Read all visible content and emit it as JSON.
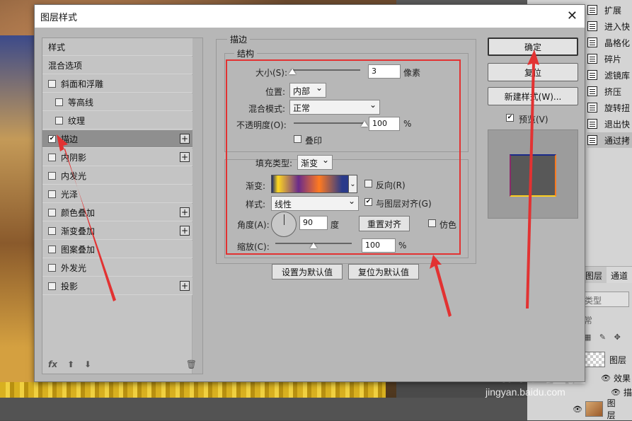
{
  "background": {
    "right_panel_items": [
      "扩展",
      "进入快",
      "晶格化",
      "碎片",
      "滤镜库",
      "挤压",
      "旋转扭",
      "退出快",
      "通过拷"
    ],
    "layers_tabs": {
      "other": "图层",
      "channels": "通道"
    },
    "filter_kind": "类型",
    "blend_normal": "常",
    "layers": [
      {
        "name": "图层",
        "kind": "checker"
      },
      {
        "name": "效果",
        "kind": "effect"
      },
      {
        "name": "描",
        "kind": "effect-sub"
      },
      {
        "name": "图层",
        "kind": "photo"
      }
    ],
    "watermark": {
      "line1": "Baidu 经验",
      "line2": "jingyan.baidu.com"
    }
  },
  "dialog": {
    "title": "图层样式",
    "close_glyph": "✕",
    "styles_list": [
      {
        "label": "样式",
        "checkbox": false,
        "checked": false,
        "indent": false,
        "plus": false,
        "selected": false
      },
      {
        "label": "混合选项",
        "checkbox": false,
        "checked": false,
        "indent": false,
        "plus": false,
        "selected": false
      },
      {
        "label": "斜面和浮雕",
        "checkbox": true,
        "checked": false,
        "indent": false,
        "plus": false,
        "selected": false
      },
      {
        "label": "等高线",
        "checkbox": true,
        "checked": false,
        "indent": true,
        "plus": false,
        "selected": false
      },
      {
        "label": "纹理",
        "checkbox": true,
        "checked": false,
        "indent": true,
        "plus": false,
        "selected": false
      },
      {
        "label": "描边",
        "checkbox": true,
        "checked": true,
        "indent": false,
        "plus": true,
        "selected": true
      },
      {
        "label": "内阴影",
        "checkbox": true,
        "checked": false,
        "indent": false,
        "plus": true,
        "selected": false
      },
      {
        "label": "内发光",
        "checkbox": true,
        "checked": false,
        "indent": false,
        "plus": false,
        "selected": false
      },
      {
        "label": "光泽",
        "checkbox": true,
        "checked": false,
        "indent": false,
        "plus": false,
        "selected": false
      },
      {
        "label": "颜色叠加",
        "checkbox": true,
        "checked": false,
        "indent": false,
        "plus": true,
        "selected": false
      },
      {
        "label": "渐变叠加",
        "checkbox": true,
        "checked": false,
        "indent": false,
        "plus": true,
        "selected": false
      },
      {
        "label": "图案叠加",
        "checkbox": true,
        "checked": false,
        "indent": false,
        "plus": false,
        "selected": false
      },
      {
        "label": "外发光",
        "checkbox": true,
        "checked": false,
        "indent": false,
        "plus": false,
        "selected": false
      },
      {
        "label": "投影",
        "checkbox": true,
        "checked": false,
        "indent": false,
        "plus": true,
        "selected": false
      }
    ],
    "list_footer": {
      "fx": "fx",
      "up": "⬆",
      "down": "⬇",
      "trash": "🗑"
    },
    "stroke": {
      "group_title": "描边",
      "structure_title": "结构",
      "size_label": "大小(S):",
      "size_value": "3",
      "size_unit": "像素",
      "position_label": "位置:",
      "position_value": "内部",
      "blend_label": "混合模式:",
      "blend_value": "正常",
      "opacity_label": "不透明度(O):",
      "opacity_value": "100",
      "opacity_unit": "%",
      "overprint_label": "叠印",
      "fill_type_label": "填充类型:",
      "fill_type_value": "渐变",
      "gradient_label": "渐变:",
      "reverse_label": "反向(R)",
      "style_label": "样式:",
      "style_value": "线性",
      "align_label": "与图层对齐(G)",
      "angle_label": "角度(A):",
      "angle_value": "90",
      "angle_unit": "度",
      "reset_align_label": "重置对齐",
      "dither_label": "仿色",
      "scale_label": "缩放(C):",
      "scale_value": "100",
      "scale_unit": "%",
      "make_default": "设置为默认值",
      "reset_default": "复位为默认值"
    },
    "buttons": {
      "ok": "确定",
      "cancel": "复位",
      "new_style": "新建样式(W)...",
      "preview_label": "预览(V)"
    },
    "slider_levels": {
      "size": 0.02,
      "opacity": 1.0,
      "scale": 0.5
    },
    "annotation_color": "#e23232"
  }
}
